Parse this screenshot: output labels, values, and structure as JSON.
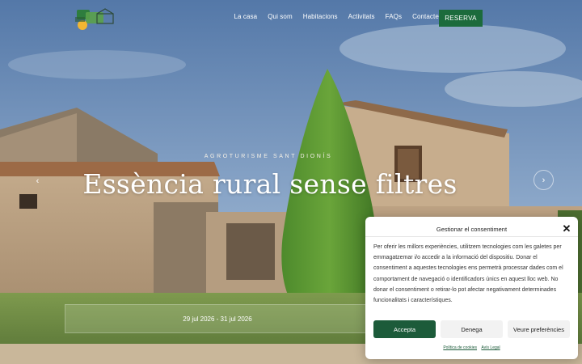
{
  "header": {
    "nav": [
      "La casa",
      "Qui som",
      "Habitacions",
      "Activitats",
      "FAQs",
      "Contacte"
    ],
    "cta_label": "RESERVA"
  },
  "hero": {
    "eyebrow": "AGROTURISME SANT DIONÍS",
    "title": "Essència rural sense filtres",
    "prev_icon": "‹",
    "next_icon": "›",
    "booking_dates": "29 jul 2026 - 31 jul 2026"
  },
  "consent": {
    "title": "Gestionar el consentiment",
    "close_icon": "✕",
    "body": "Per oferir les millors experiències, utilitzem tecnologies com les galetes per emmagatzemar i/o accedir a la informació del dispositiu. Donar el consentiment a aquestes tecnologies ens permetrà processar dades com el comportament de navegació o identificadors únics en aquest lloc web. No donar el consentiment o retirar-lo pot afectar negativament determinades funcionalitats i característiques.",
    "accept_label": "Accepta",
    "deny_label": "Denega",
    "prefs_label": "Veure preferències",
    "links": [
      "Política de cookies",
      "Avís Legal"
    ]
  },
  "colors": {
    "brand_green": "#1c6b3c",
    "accept_green": "#1c5b3a"
  },
  "icons": {
    "logo": "house-logo",
    "close": "close-icon",
    "prev": "chevron-left-icon",
    "next": "chevron-right-icon"
  }
}
